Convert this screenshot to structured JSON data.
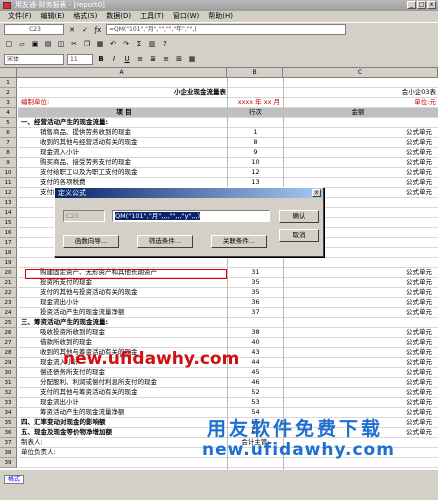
{
  "window": {
    "title": "用友通-财务报表 - [report0]",
    "buttons": [
      "_",
      "□",
      "x"
    ]
  },
  "menubar": {
    "items": [
      "文件(F)",
      "编辑(E)",
      "格式(S)",
      "数据(D)",
      "工具(T)",
      "窗口(W)",
      "帮助(H)"
    ]
  },
  "formula_bar": {
    "cell_ref": "C23",
    "formula": "=QM(\"101\",\"月\",\"\",\"\",\"年\",\"\",)"
  },
  "font_bar": {
    "font": "宋体",
    "size": "11"
  },
  "columns": [
    "A",
    "B",
    "C"
  ],
  "sheet": {
    "title": "小企业现金流量表",
    "form_no": "会小企03表",
    "unit_label": "编制单位:",
    "date_label": "xxxx 年 xx 月",
    "currency_label": "单位:元",
    "header_item": "项 目",
    "header_row": "行次",
    "header_amount": "金额",
    "rows": [
      {
        "n": "1",
        "item": "",
        "line": "",
        "amount": ""
      },
      {
        "n": "2",
        "item": "",
        "line": "",
        "amount": ""
      },
      {
        "n": "3",
        "item": "编制单位:",
        "line": "",
        "amount": ""
      },
      {
        "n": "4",
        "item": "项 目",
        "line": "行次",
        "amount": "金额"
      },
      {
        "n": "5",
        "item": "一、经营活动产生的现金流量:",
        "line": "",
        "amount": ""
      },
      {
        "n": "6",
        "item": "销售商品、提供劳务收到的现金",
        "line": "1",
        "amount": "公式单元"
      },
      {
        "n": "7",
        "item": "收到的其他与经营活动有关的现金",
        "line": "8",
        "amount": "公式单元"
      },
      {
        "n": "8",
        "item": "现金流入小计",
        "line": "9",
        "amount": "公式单元"
      },
      {
        "n": "9",
        "item": "购买商品、接受劳务支付的现金",
        "line": "10",
        "amount": "公式单元"
      },
      {
        "n": "10",
        "item": "支付给职工以及为职工支付的现金",
        "line": "12",
        "amount": "公式单元"
      },
      {
        "n": "11",
        "item": "支付的各项税费",
        "line": "13",
        "amount": "公式单元"
      },
      {
        "n": "12",
        "item": "支付的其他与经营活动有关的现金",
        "line": "18",
        "amount": "公式单元"
      },
      {
        "n": "13",
        "item": "",
        "line": "",
        "amount": ""
      },
      {
        "n": "14",
        "item": "",
        "line": "",
        "amount": ""
      },
      {
        "n": "15",
        "item": "",
        "line": "",
        "amount": ""
      },
      {
        "n": "16",
        "item": "",
        "line": "",
        "amount": ""
      },
      {
        "n": "17",
        "item": "",
        "line": "",
        "amount": ""
      },
      {
        "n": "18",
        "item": "",
        "line": "",
        "amount": ""
      },
      {
        "n": "19",
        "item": "",
        "line": "",
        "amount": ""
      },
      {
        "n": "20",
        "item": "购建固定资产、无形资产和其他长期资产",
        "line": "31",
        "amount": "公式单元"
      },
      {
        "n": "21",
        "item": "投资所支付的现金",
        "line": "35",
        "amount": "公式单元"
      },
      {
        "n": "22",
        "item": "支付的其他与投资活动有关的现金",
        "line": "35",
        "amount": "公式单元"
      },
      {
        "n": "23",
        "item": "现金流出小计",
        "line": "36",
        "amount": "公式单元"
      },
      {
        "n": "24",
        "item": "投资活动产生的现金流量净额",
        "line": "37",
        "amount": "公式单元"
      },
      {
        "n": "25",
        "item": "三、筹资活动产生的现金流量:",
        "line": "",
        "amount": ""
      },
      {
        "n": "26",
        "item": "吸收投资所收到的现金",
        "line": "38",
        "amount": "公式单元"
      },
      {
        "n": "27",
        "item": "借款所收到的现金",
        "line": "40",
        "amount": "公式单元"
      },
      {
        "n": "28",
        "item": "收到的其他与筹资活动有关的现金",
        "line": "43",
        "amount": "公式单元"
      },
      {
        "n": "29",
        "item": "现金流入小计",
        "line": "44",
        "amount": "公式单元"
      },
      {
        "n": "30",
        "item": "偿还债务所支付的现金",
        "line": "45",
        "amount": "公式单元"
      },
      {
        "n": "31",
        "item": "分配股利、利润或偿付利息所支付的现金",
        "line": "46",
        "amount": "公式单元"
      },
      {
        "n": "32",
        "item": "支付的其他与筹资活动有关的现金",
        "line": "52",
        "amount": "公式单元"
      },
      {
        "n": "33",
        "item": "现金流出小计",
        "line": "53",
        "amount": "公式单元"
      },
      {
        "n": "34",
        "item": "筹资活动产生的现金流量净额",
        "line": "54",
        "amount": "公式单元"
      },
      {
        "n": "35",
        "item": "四、汇率变动对现金的影响额",
        "line": "55",
        "amount": "公式单元"
      },
      {
        "n": "36",
        "item": "五、现金及现金等价物净增加额",
        "line": "56",
        "amount": "公式单元"
      },
      {
        "n": "37",
        "item": "制表人:",
        "line": "会计主管:",
        "amount": ""
      },
      {
        "n": "38",
        "item": "单位负责人:",
        "line": "",
        "amount": ""
      },
      {
        "n": "39",
        "item": "",
        "line": "",
        "amount": ""
      }
    ]
  },
  "dialog": {
    "title": "定义公式",
    "cell_ref": "C23",
    "formula": "QM(\"101\",\"月\",,,,\"\",,,\"y\",,,)",
    "btn_function": "函数向导...",
    "btn_filter": "筛选条件...",
    "btn_relation": "关联条件...",
    "btn_ok": "确认",
    "btn_cancel": "取消"
  },
  "status": {
    "mode_tab": "格式"
  },
  "watermarks": {
    "top": "new.ufidawhy.com",
    "cn": "用友软件免费下载",
    "url": "new.ufidawhy.com"
  },
  "colors": {
    "red": "#cf1010",
    "blue": "#1e6fd0",
    "dialog_title": "#0a246a"
  }
}
